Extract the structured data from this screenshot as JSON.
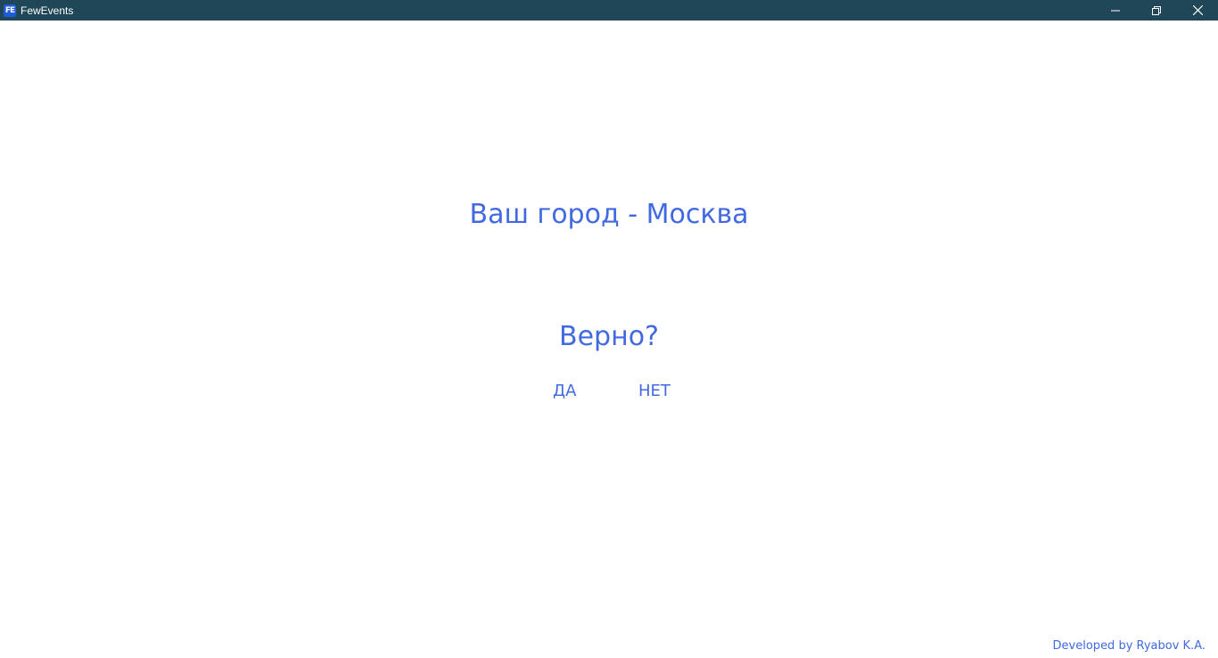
{
  "window": {
    "title": "FewEvents",
    "icon_label": "FE",
    "icon": "app-logo-icon"
  },
  "controls": {
    "minimize_icon": "minimize-icon",
    "maximize_icon": "restore-icon",
    "close_icon": "close-icon"
  },
  "main": {
    "headline": "Ваш город - Москва",
    "question": "Верно?",
    "yes_label": "ДА",
    "no_label": "НЕТ"
  },
  "footer": {
    "credit": "Developed by Ryabov K.A."
  },
  "colors": {
    "titlebar": "#1f4757",
    "accent": "#4169e1",
    "background": "#ffffff"
  }
}
